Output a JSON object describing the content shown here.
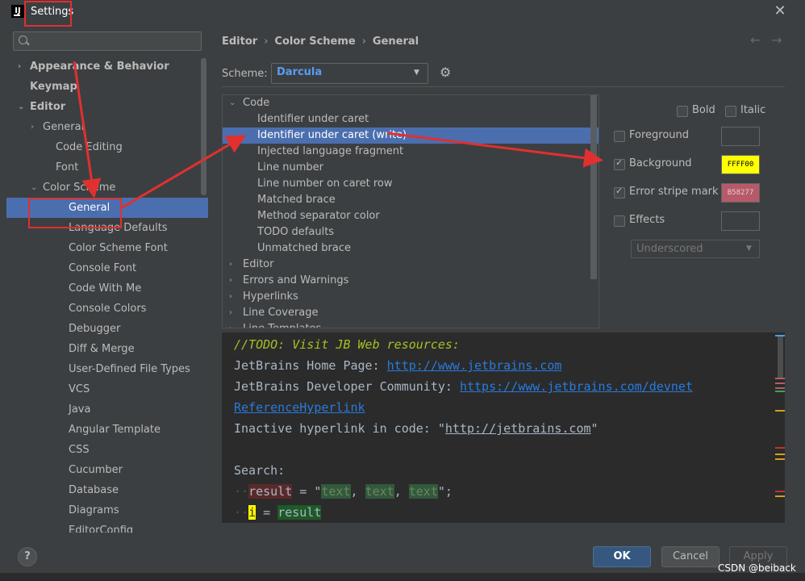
{
  "window": {
    "title": "Settings",
    "close_glyph": "✕"
  },
  "sidebar": {
    "search_placeholder": "",
    "items": [
      {
        "label": "Appearance & Behavior",
        "level": 0,
        "arrow": "›",
        "bold": true
      },
      {
        "label": "Keymap",
        "level": 0,
        "arrow": "",
        "bold": true
      },
      {
        "label": "Editor",
        "level": 0,
        "arrow": "⌄",
        "bold": true
      },
      {
        "label": "General",
        "level": 1,
        "arrow": "›"
      },
      {
        "label": "Code Editing",
        "level": 2,
        "arrow": ""
      },
      {
        "label": "Font",
        "level": 2,
        "arrow": ""
      },
      {
        "label": "Color Scheme",
        "level": 1,
        "arrow": "⌄"
      },
      {
        "label": "General",
        "level": 3,
        "arrow": "",
        "selected": true
      },
      {
        "label": "Language Defaults",
        "level": 3
      },
      {
        "label": "Color Scheme Font",
        "level": 3
      },
      {
        "label": "Console Font",
        "level": 3
      },
      {
        "label": "Code With Me",
        "level": 3
      },
      {
        "label": "Console Colors",
        "level": 3
      },
      {
        "label": "Debugger",
        "level": 3
      },
      {
        "label": "Diff & Merge",
        "level": 3
      },
      {
        "label": "User-Defined File Types",
        "level": 3
      },
      {
        "label": "VCS",
        "level": 3
      },
      {
        "label": "Java",
        "level": 3
      },
      {
        "label": "Angular Template",
        "level": 3
      },
      {
        "label": "CSS",
        "level": 3
      },
      {
        "label": "Cucumber",
        "level": 3
      },
      {
        "label": "Database",
        "level": 3
      },
      {
        "label": "Diagrams",
        "level": 3
      },
      {
        "label": "EditorConfig",
        "level": 3
      }
    ]
  },
  "breadcrumb": [
    "Editor",
    "Color Scheme",
    "General"
  ],
  "nav": {
    "back": "←",
    "forward": "→"
  },
  "scheme": {
    "label": "Scheme:",
    "value": "Darcula",
    "caret": "▼",
    "gear": "⚙"
  },
  "list": [
    {
      "label": "Code",
      "level": 0,
      "arrow": "⌄"
    },
    {
      "label": "Identifier under caret",
      "level": 1
    },
    {
      "label": "Identifier under caret (write)",
      "level": 1,
      "selected": true
    },
    {
      "label": "Injected language fragment",
      "level": 1
    },
    {
      "label": "Line number",
      "level": 1
    },
    {
      "label": "Line number on caret row",
      "level": 1
    },
    {
      "label": "Matched brace",
      "level": 1
    },
    {
      "label": "Method separator color",
      "level": 1
    },
    {
      "label": "TODO defaults",
      "level": 1
    },
    {
      "label": "Unmatched brace",
      "level": 1
    },
    {
      "label": "Editor",
      "level": 0,
      "arrow": "›"
    },
    {
      "label": "Errors and Warnings",
      "level": 0,
      "arrow": "›"
    },
    {
      "label": "Hyperlinks",
      "level": 0,
      "arrow": "›"
    },
    {
      "label": "Line Coverage",
      "level": 0,
      "arrow": "›"
    },
    {
      "label": "Line Templates",
      "level": 0,
      "arrow": "›"
    }
  ],
  "attributes": {
    "bold": {
      "label": "Bold",
      "checked": false
    },
    "italic": {
      "label": "Italic",
      "checked": false
    },
    "foreground": {
      "label": "Foreground",
      "checked": false,
      "color": ""
    },
    "background": {
      "label": "Background",
      "checked": true,
      "color": "FFFF00",
      "hex": "#ffff00"
    },
    "error_stripe": {
      "label": "Error stripe mark",
      "checked": true,
      "color": "B58277",
      "hex": "#b65a6a"
    },
    "effects": {
      "label": "Effects",
      "checked": false,
      "color": ""
    },
    "effect_type": "Underscored"
  },
  "preview": {
    "todo": "//TODO: Visit JB Web resources:",
    "home_label": "JetBrains Home Page: ",
    "home_url": "http://www.jetbrains.com",
    "dev_label": "JetBrains Developer Community: ",
    "dev_url": "https://www.jetbrains.com/devnet",
    "ref_link": "ReferenceHyperlink",
    "inactive_prefix": "Inactive hyperlink in code: \"",
    "inactive_url": "http://jetbrains.com",
    "inactive_suffix": "\"",
    "search": "Search:",
    "line1": {
      "var": "result",
      "eq": " = \"",
      "t1": "text",
      "c1": ", ",
      "t2": "text",
      "c2": ", ",
      "t3": "text",
      "end": "\";"
    },
    "line2": {
      "var": "i",
      "eq": " = ",
      "val": "result"
    }
  },
  "footer": {
    "help": "?",
    "ok": "OK",
    "cancel": "Cancel",
    "apply": "Apply"
  },
  "watermark": "CSDN @beiback",
  "colors": {
    "accent": "#4b6eaf",
    "annotation": "#e03030"
  }
}
